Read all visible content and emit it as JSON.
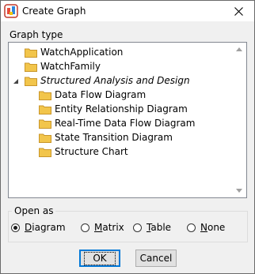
{
  "window": {
    "title": "Create Graph",
    "app_icon": "app-icon",
    "close_icon": "close-icon"
  },
  "graph_type": {
    "label": "Graph type",
    "items": [
      {
        "label": "WatchApplication",
        "icon": "folder-icon"
      },
      {
        "label": "WatchFamily",
        "icon": "folder-icon"
      },
      {
        "label": "Structured Analysis and Design",
        "icon": "folder-icon",
        "expanded": true,
        "italic": true,
        "children": [
          {
            "label": "Data Flow Diagram",
            "icon": "folder-icon"
          },
          {
            "label": "Entity Relationship Diagram",
            "icon": "folder-icon"
          },
          {
            "label": "Real-Time Data Flow Diagram",
            "icon": "folder-icon"
          },
          {
            "label": "State Transition Diagram",
            "icon": "folder-icon"
          },
          {
            "label": "Structure Chart",
            "icon": "folder-icon"
          }
        ]
      }
    ]
  },
  "open_as": {
    "label": "Open as",
    "selected": "Diagram",
    "options": [
      {
        "label": "Diagram",
        "checked": true
      },
      {
        "label": "Matrix",
        "checked": false
      },
      {
        "label": "Table",
        "checked": false
      },
      {
        "label": "None",
        "checked": false
      }
    ]
  },
  "buttons": {
    "ok": "OK",
    "cancel": "Cancel"
  },
  "colors": {
    "folder": "#f2c54b",
    "focus": "#0078d7"
  }
}
